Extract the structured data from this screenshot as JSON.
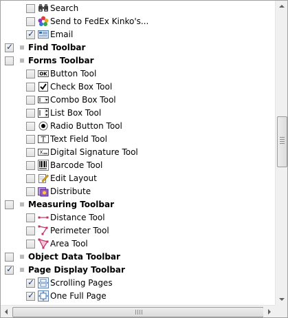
{
  "items": [
    {
      "label": "Search",
      "level": 1,
      "checked": false,
      "bold": false,
      "icon": "binoculars-icon"
    },
    {
      "label": "Send to FedEx Kinko's...",
      "level": 1,
      "checked": false,
      "bold": false,
      "icon": "fedex-kinkos-icon"
    },
    {
      "label": "Email",
      "level": 1,
      "checked": true,
      "bold": false,
      "icon": "email-icon"
    },
    {
      "label": "Find Toolbar",
      "level": 0,
      "checked": true,
      "bold": true,
      "icon": null
    },
    {
      "label": "Forms Toolbar",
      "level": 0,
      "checked": false,
      "bold": true,
      "icon": null
    },
    {
      "label": "Button Tool",
      "level": 1,
      "checked": false,
      "bold": false,
      "icon": "ok-button-icon"
    },
    {
      "label": "Check Box Tool",
      "level": 1,
      "checked": false,
      "bold": false,
      "icon": "checkbox-icon"
    },
    {
      "label": "Combo Box Tool",
      "level": 1,
      "checked": false,
      "bold": false,
      "icon": "combo-box-icon"
    },
    {
      "label": "List Box Tool",
      "level": 1,
      "checked": false,
      "bold": false,
      "icon": "list-box-icon"
    },
    {
      "label": "Radio Button Tool",
      "level": 1,
      "checked": false,
      "bold": false,
      "icon": "radio-button-icon"
    },
    {
      "label": "Text Field Tool",
      "level": 1,
      "checked": false,
      "bold": false,
      "icon": "text-field-icon"
    },
    {
      "label": "Digital Signature Tool",
      "level": 1,
      "checked": false,
      "bold": false,
      "icon": "digital-signature-icon"
    },
    {
      "label": "Barcode Tool",
      "level": 1,
      "checked": false,
      "bold": false,
      "icon": "barcode-icon"
    },
    {
      "label": "Edit Layout",
      "level": 1,
      "checked": false,
      "bold": false,
      "icon": "edit-layout-icon"
    },
    {
      "label": "Distribute",
      "level": 1,
      "checked": false,
      "bold": false,
      "icon": "distribute-icon"
    },
    {
      "label": "Measuring Toolbar",
      "level": 0,
      "checked": false,
      "bold": true,
      "icon": null
    },
    {
      "label": "Distance Tool",
      "level": 1,
      "checked": false,
      "bold": false,
      "icon": "distance-icon"
    },
    {
      "label": "Perimeter Tool",
      "level": 1,
      "checked": false,
      "bold": false,
      "icon": "perimeter-icon"
    },
    {
      "label": "Area Tool",
      "level": 1,
      "checked": false,
      "bold": false,
      "icon": "area-icon"
    },
    {
      "label": "Object Data Toolbar",
      "level": 0,
      "checked": false,
      "bold": true,
      "icon": null
    },
    {
      "label": "Page Display Toolbar",
      "level": 0,
      "checked": true,
      "bold": true,
      "icon": null
    },
    {
      "label": "Scrolling Pages",
      "level": 1,
      "checked": true,
      "bold": false,
      "icon": "scrolling-pages-icon"
    },
    {
      "label": "One Full Page",
      "level": 1,
      "checked": true,
      "bold": false,
      "icon": "one-full-page-icon"
    }
  ]
}
